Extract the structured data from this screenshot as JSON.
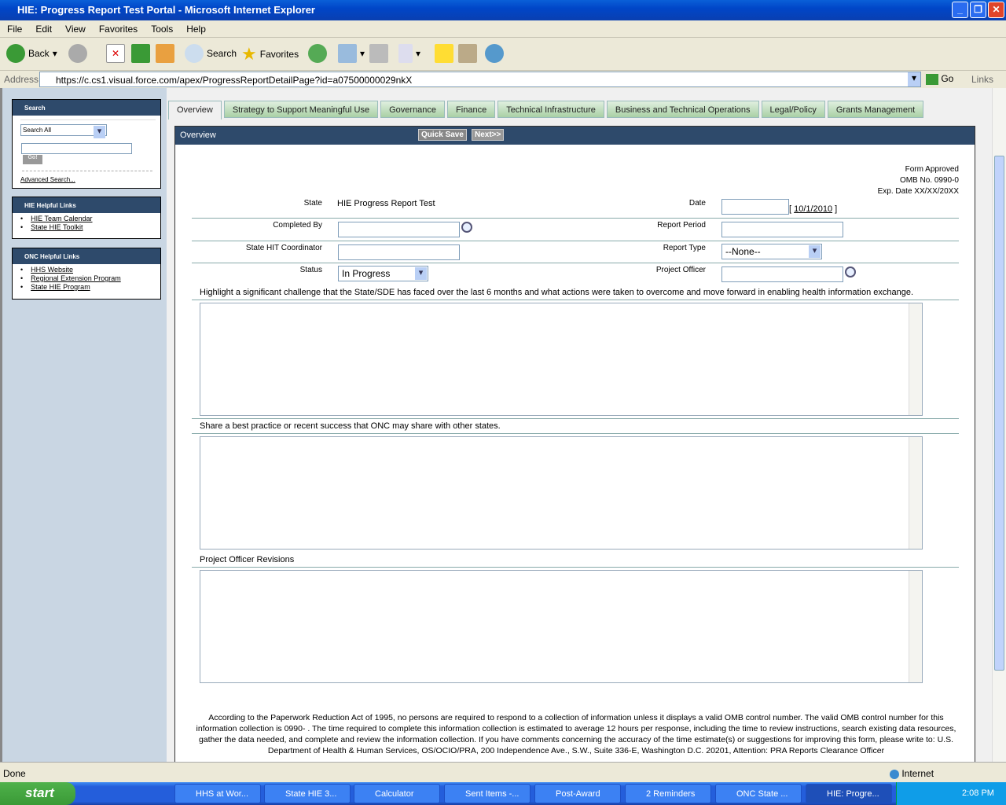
{
  "window": {
    "title": "HIE: Progress Report Test Portal - Microsoft Internet Explorer"
  },
  "menu": [
    "File",
    "Edit",
    "View",
    "Favorites",
    "Tools",
    "Help"
  ],
  "toolbar": {
    "back": "Back",
    "search": "Search",
    "favorites": "Favorites"
  },
  "address": {
    "label": "Address",
    "url": "https://c.cs1.visual.force.com/apex/ProgressReportDetailPage?id=a07500000029nkX",
    "go": "Go",
    "links": "Links"
  },
  "sidebar": {
    "search": {
      "title": "Search",
      "scope": "Search All",
      "go": "Go!",
      "advanced": "Advanced Search..."
    },
    "hie_links": {
      "title": "HIE Helpful Links",
      "items": [
        "HIE Team Calendar",
        "State HIE Toolkit"
      ]
    },
    "onc_links": {
      "title": "ONC Helpful Links",
      "items": [
        "HHS Website",
        "Regional Extension Program",
        "State HIE Program"
      ]
    }
  },
  "tabs": [
    "Overview",
    "Strategy to Support Meaningful Use",
    "Governance",
    "Finance",
    "Technical Infrastructure",
    "Business and Technical Operations",
    "Legal/Policy",
    "Grants Management"
  ],
  "panel": {
    "title": "Overview",
    "quick_save": "Quick Save",
    "next": "Next>>"
  },
  "form": {
    "approval": [
      "Form Approved",
      "OMB No. 0990-0",
      "Exp. Date XX/XX/20XX"
    ],
    "state_label": "State",
    "state_value": "HIE Progress Report Test",
    "date_label": "Date",
    "date_link": "10/1/2010",
    "completed_by_label": "Completed By",
    "report_period_label": "Report Period",
    "coordinator_label": "State HIT Coordinator",
    "report_type_label": "Report Type",
    "report_type_value": "--None--",
    "status_label": "Status",
    "status_value": "In Progress",
    "officer_label": "Project Officer",
    "q1": "Highlight a significant challenge that the State/SDE has faced over the last 6 months and what actions were taken to overcome and move forward in enabling health information exchange.",
    "q2": "Share a best practice or recent success that ONC may share with other states.",
    "q3": "Project Officer Revisions",
    "disclaimer": "According to the Paperwork Reduction Act of 1995, no persons are required to respond to a collection of information unless it displays a valid OMB control number. The valid OMB control number for this information collection is 0990- . The time required to complete this information collection is estimated to average 12 hours per response, including the time to review instructions, search existing data resources, gather the data needed, and complete and review the information collection. If you have comments concerning the accuracy of the time estimate(s) or suggestions for improving this form, please write to: U.S. Department of Health & Human Services, OS/OCIO/PRA, 200 Independence Ave., S.W., Suite 336-E, Washington D.C. 20201, Attention: PRA Reports Clearance Officer"
  },
  "status": {
    "text": "Done",
    "zone": "Internet"
  },
  "taskbar": {
    "start": "start",
    "tasks": [
      "HHS at Wor...",
      "State HIE 3...",
      "Calculator",
      "Sent Items -...",
      "Post-Award",
      "2 Reminders",
      "ONC State ...",
      "HIE: Progre..."
    ],
    "clock": "2:08 PM"
  }
}
